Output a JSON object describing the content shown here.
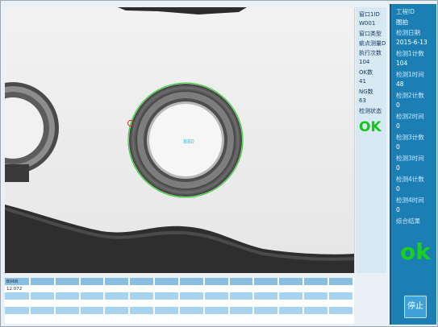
{
  "camera": {
    "overlay_label": "B80"
  },
  "status_panel": {
    "window_id_label": "窗口1ID",
    "window_id_value": "W001",
    "window_type_label": "窗口类型",
    "distance_label": "疵点测量D",
    "exec_count_label": "执行次数",
    "exec_count_value": "104",
    "ok_count_label": "OK数",
    "ok_count_value": "41",
    "ng_count_label": "NG数",
    "ng_count_value": "63",
    "detect_status_label": "检测状态",
    "result": "OK"
  },
  "right_panel": {
    "project_id_label": "工程ID",
    "project_id_value": "图拍",
    "date_label": "检测日期",
    "date_value": "2015-6-13",
    "count1_label": "检测1计数",
    "count1_value": "104",
    "time1_label": "检测1时间",
    "time1_value": "48",
    "count2_label": "检测2计数",
    "count2_value": "0",
    "time2_label": "检测2时间",
    "time2_value": "0",
    "count3_label": "检测3计数",
    "count3_value": "0",
    "time3_label": "检测3时间",
    "time3_value": "0",
    "count4_label": "检测4计数",
    "count4_value": "0",
    "time4_label": "检测4时间",
    "time4_value": "0",
    "overall_label": "综合结果",
    "overall_result": "ok",
    "stop_button": "停止"
  },
  "results_table": {
    "header_first": "B068",
    "value_first": "12.072"
  },
  "colors": {
    "ok_green": "#14c51a",
    "panel_blue": "#1c7fb4",
    "table_blue": "#a8d3ee",
    "detect_contour": "#3cd23c"
  }
}
